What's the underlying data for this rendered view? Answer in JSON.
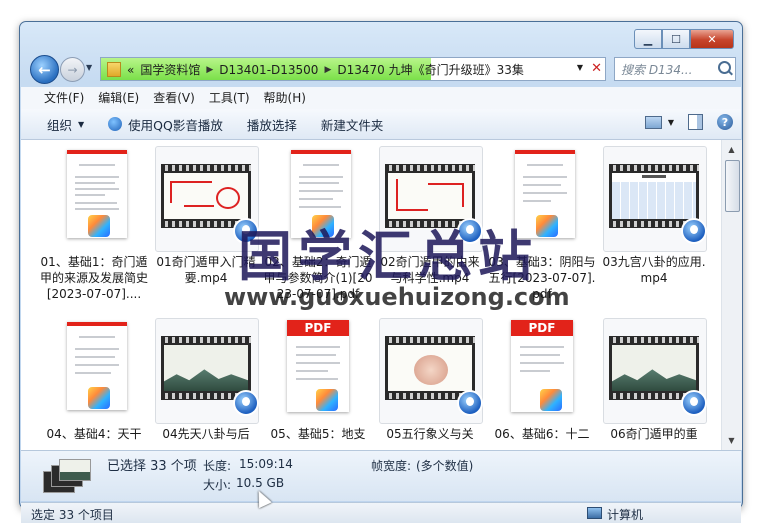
{
  "window": {
    "min_label": "▁",
    "max_label": "☐",
    "close_label": "✕"
  },
  "nav": {
    "back": "←",
    "forward": "→",
    "crumbs": [
      "«",
      "国学资料馆",
      "D13401-D13500",
      "D13470 九坤《奇门升级班》33集"
    ],
    "search_placeholder": "搜索 D134..."
  },
  "menu": [
    "文件(F)",
    "编辑(E)",
    "查看(V)",
    "工具(T)",
    "帮助(H)"
  ],
  "toolbar": {
    "organize": "组织",
    "play_qq": "使用QQ影音播放",
    "play_select": "播放选择",
    "new_folder": "新建文件夹",
    "help": "?"
  },
  "files": [
    {
      "type": "pdf-doc",
      "label": "01、基础1：奇门遁甲的来源及发展简史[2023-07-07]...."
    },
    {
      "type": "video",
      "label": "01奇门遁甲入门精要.mp4"
    },
    {
      "type": "pdf-doc",
      "label": "02、基础2：奇门遁甲与参数简介(1)[2023-07-07].pdf"
    },
    {
      "type": "video",
      "label": "02奇门遁甲的由来与科学性.mp4"
    },
    {
      "type": "pdf-doc",
      "label": "03、基础3：阴阳与五行[2023-07-07].pdf"
    },
    {
      "type": "video",
      "label": "03九宫八卦的应用.mp4"
    },
    {
      "type": "pdf-doc",
      "label": "04、基础4：天干"
    },
    {
      "type": "video",
      "label": "04先天八卦与后"
    },
    {
      "type": "pdf-big",
      "label": "05、基础5：地支"
    },
    {
      "type": "video",
      "label": "05五行象义与关"
    },
    {
      "type": "pdf-big",
      "label": "06、基础6：十二"
    },
    {
      "type": "video",
      "label": "06奇门遁甲的重"
    }
  ],
  "pdf_badge_text": "PDF",
  "details": {
    "selected": "已选择 33 个项",
    "duration_key": "长度:",
    "duration_val": "15:09:14",
    "size_key": "大小:",
    "size_val": "10.5 GB",
    "fw_key": "帧宽度:",
    "fw_val": "(多个数值)"
  },
  "status": {
    "left": "选定 33 个项目",
    "right": "计算机"
  },
  "watermark": {
    "cn": "国学汇总站",
    "url": "www.guoxuehuizong.com"
  },
  "colors": {
    "address_fill": "#7be04a",
    "pdf_red": "#e2231a",
    "close_red": "#c7442b"
  }
}
